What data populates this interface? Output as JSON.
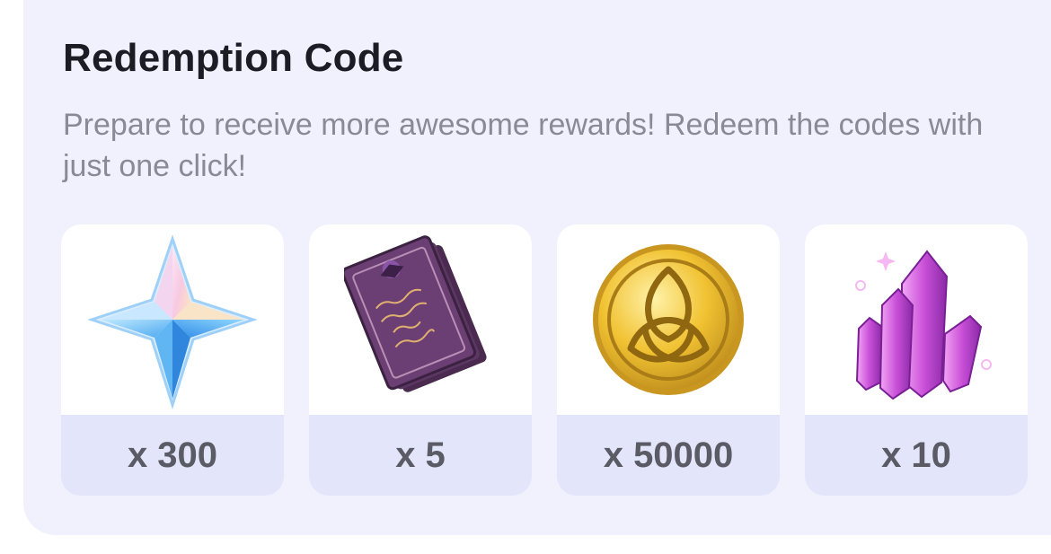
{
  "redemption": {
    "title": "Redemption Code",
    "description": "Prepare to receive more awesome rewards! Redeem the codes with just one click!",
    "rewards": [
      {
        "icon": "primogem-icon",
        "quantity": "x 300"
      },
      {
        "icon": "heros-wit-book-icon",
        "quantity": "x 5"
      },
      {
        "icon": "mora-coin-icon",
        "quantity": "x 50000"
      },
      {
        "icon": "purple-crystal-icon",
        "quantity": "x 10"
      }
    ]
  },
  "colors": {
    "card_background": "#f0f1fd",
    "tile_background": "#e3e5fb",
    "title": "#1c1c24",
    "description": "#8a8a94",
    "quantity": "#5b5b66"
  }
}
